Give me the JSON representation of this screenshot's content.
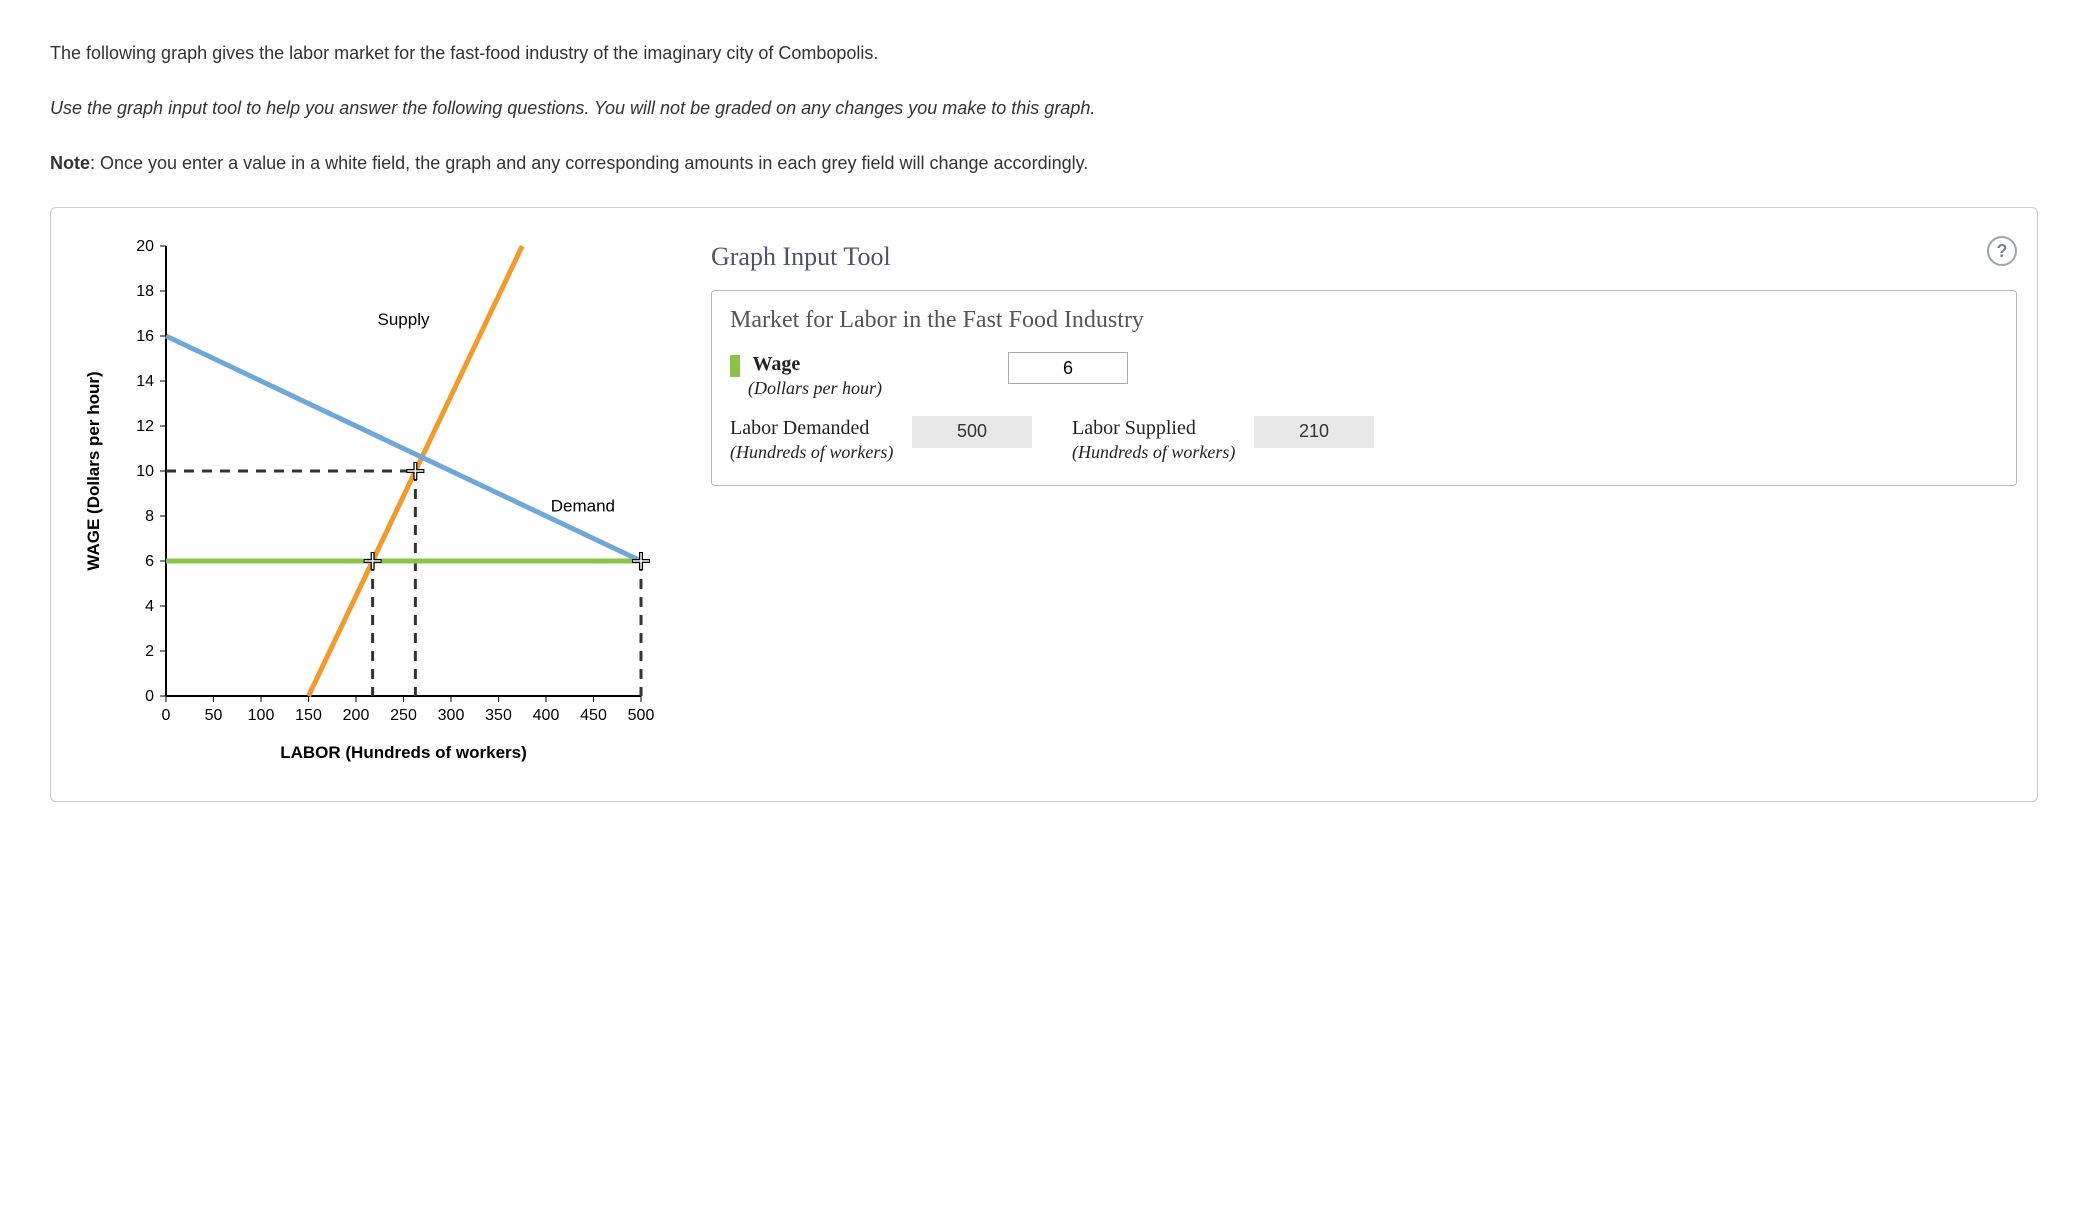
{
  "intro": {
    "p1": "The following graph gives the labor market for the fast-food industry of the imaginary city of Combopolis.",
    "p2": "Use the graph input tool to help you answer the following questions. You will not be graded on any changes you make to this graph.",
    "note_strong": "Note",
    "note_rest": ": Once you enter a value in a white field, the graph and any corresponding amounts in each grey field will change accordingly."
  },
  "panel": {
    "title": "Graph Input Tool",
    "subtitle": "Market for Labor in the Fast Food Industry",
    "wage_label": "Wage",
    "wage_unit": "(Dollars per hour)",
    "wage_value": "6",
    "demand_label": "Labor Demanded",
    "demand_unit": "(Hundreds of workers)",
    "demand_value": "500",
    "supply_label": "Labor Supplied",
    "supply_unit": "(Hundreds of workers)",
    "supply_value": "210",
    "help": "?"
  },
  "chart": {
    "ylabel": "WAGE (Dollars per hour)",
    "xlabel": "LABOR (Hundreds of workers)",
    "supply_label": "Supply",
    "demand_label": "Demand",
    "xticks": [
      "0",
      "50",
      "100",
      "150",
      "200",
      "250",
      "300",
      "350",
      "400",
      "450",
      "500"
    ],
    "yticks": [
      "0",
      "2",
      "4",
      "6",
      "8",
      "10",
      "12",
      "14",
      "16",
      "18",
      "20"
    ]
  },
  "chart_data": {
    "type": "line",
    "title": "",
    "xlabel": "LABOR (Hundreds of workers)",
    "ylabel": "WAGE (Dollars per hour)",
    "xlim": [
      0,
      500
    ],
    "ylim": [
      0,
      20
    ],
    "series": [
      {
        "name": "Supply",
        "color": "#f29a2e",
        "x": [
          150,
          375
        ],
        "y": [
          0,
          20
        ]
      },
      {
        "name": "Demand",
        "color": "#6fa8d8",
        "x": [
          0,
          500
        ],
        "y": [
          16,
          6
        ]
      },
      {
        "name": "Wage line",
        "color": "#8bc34a",
        "x": [
          0,
          500
        ],
        "y": [
          6,
          6
        ]
      }
    ],
    "markers": [
      {
        "name": "intersection",
        "x": 262.5,
        "y": 10
      },
      {
        "name": "supply-at-wage",
        "x": 217.5,
        "y": 6
      },
      {
        "name": "demand-at-wage",
        "x": 500,
        "y": 6
      }
    ],
    "guides": [
      {
        "from": [
          0,
          10
        ],
        "to": [
          262.5,
          10
        ]
      },
      {
        "from": [
          262.5,
          10
        ],
        "to": [
          262.5,
          0
        ]
      },
      {
        "from": [
          217.5,
          6
        ],
        "to": [
          217.5,
          0
        ]
      },
      {
        "from": [
          500,
          6
        ],
        "to": [
          500,
          0
        ]
      }
    ]
  }
}
